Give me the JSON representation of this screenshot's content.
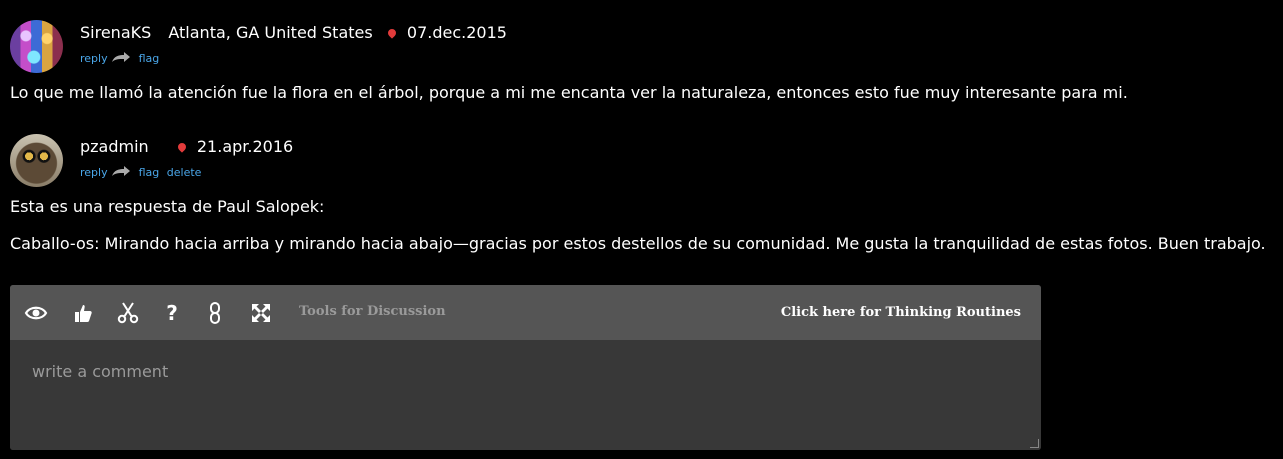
{
  "comments": [
    {
      "username": "SirenaKS",
      "location": "Atlanta, GA United States",
      "date": "07.dec.2015",
      "actions": {
        "reply": "reply",
        "flag": "flag"
      },
      "text": "Lo que me llamó la atención fue la flora en el árbol, porque a mi me encanta ver la naturaleza, entonces esto fue muy interesante para mi."
    },
    {
      "username": "pzadmin",
      "date": "21.apr.2016",
      "actions": {
        "reply": "reply",
        "flag": "flag",
        "delete": "delete"
      },
      "text_lines": [
        "Esta es una respuesta de Paul Salopek:",
        "Caballo-os: Mirando hacia arriba y mirando hacia abajo—gracias por estos destellos de su comunidad. Me gusta la tranquilidad de estas fotos. Buen trabajo."
      ]
    }
  ],
  "toolbar": {
    "icons": [
      "eye-icon",
      "thumbs-up-icon",
      "scissors-icon",
      "question-icon",
      "link-icon",
      "expand-icon"
    ],
    "tools_label": "Tools for Discussion",
    "thinking_link": "Click here for Thinking Routines"
  },
  "input": {
    "placeholder": "write a comment",
    "value": ""
  },
  "colors": {
    "background": "#000000",
    "link": "#4aa6e8",
    "toolbar": "#555555",
    "input_bg": "#383838",
    "pin": "#e23b3b"
  }
}
